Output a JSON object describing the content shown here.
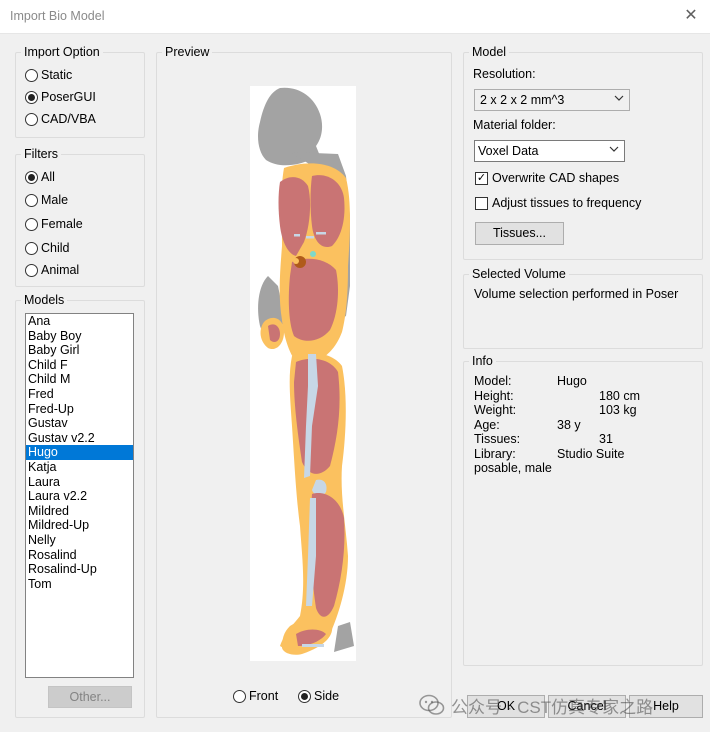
{
  "window": {
    "title": "Import Bio Model",
    "close_glyph": "✕"
  },
  "import_option": {
    "legend": "Import Option",
    "options": [
      {
        "label": "Static",
        "selected": false
      },
      {
        "label": "PoserGUI",
        "selected": true
      },
      {
        "label": "CAD/VBA",
        "selected": false
      }
    ]
  },
  "filters": {
    "legend": "Filters",
    "options": [
      {
        "label": "All",
        "selected": true
      },
      {
        "label": "Male",
        "selected": false
      },
      {
        "label": "Female",
        "selected": false
      },
      {
        "label": "Child",
        "selected": false
      },
      {
        "label": "Animal",
        "selected": false
      }
    ]
  },
  "models": {
    "legend": "Models",
    "items": [
      "Ana",
      "Baby Boy",
      "Baby Girl",
      "Child F",
      "Child M",
      "Fred",
      "Fred-Up",
      "Gustav",
      "Gustav v2.2",
      "Hugo",
      "Katja",
      "Laura",
      "Laura v2.2",
      "Mildred",
      "Mildred-Up",
      "Nelly",
      "Rosalind",
      "Rosalind-Up",
      "Tom"
    ],
    "selected_index": 9,
    "other_button": "Other..."
  },
  "preview": {
    "legend": "Preview",
    "view_options": [
      {
        "label": "Front",
        "selected": false
      },
      {
        "label": "Side",
        "selected": true
      }
    ],
    "colors": {
      "silhouette": "#a3a3a3",
      "fat": "#fbc15f",
      "muscle": "#c97474",
      "bone": "#c7d7e6",
      "organ": "#b05b1a"
    }
  },
  "model": {
    "legend": "Model",
    "resolution_label": "Resolution:",
    "resolution_value": "2 x 2 x 2 mm^3",
    "material_folder_label": "Material folder:",
    "material_folder_value": "Voxel Data",
    "overwrite_cad_label": "Overwrite CAD shapes",
    "overwrite_cad_checked": true,
    "adjust_tissues_label": "Adjust tissues to frequency",
    "adjust_tissues_checked": false,
    "tissues_button": "Tissues..."
  },
  "selected_volume": {
    "legend": "Selected Volume",
    "text": "Volume selection performed in Poser"
  },
  "info": {
    "legend": "Info",
    "model_key": "Model:",
    "model_val": "Hugo",
    "height_key": "Height:",
    "height_val": "180 cm",
    "weight_key": "Weight:",
    "weight_val": "103 kg",
    "age_key": "Age:",
    "age_val": "38 y",
    "tissues_key": "Tissues:",
    "tissues_val": "31",
    "library_key": "Library:",
    "library_val": "Studio Suite",
    "library_val2": "posable, male"
  },
  "footer": {
    "ok_button": "OK",
    "cancel_button": "Cancel",
    "help_button": "Help",
    "watermark_text": "公众号 · CST仿真专家之路"
  }
}
